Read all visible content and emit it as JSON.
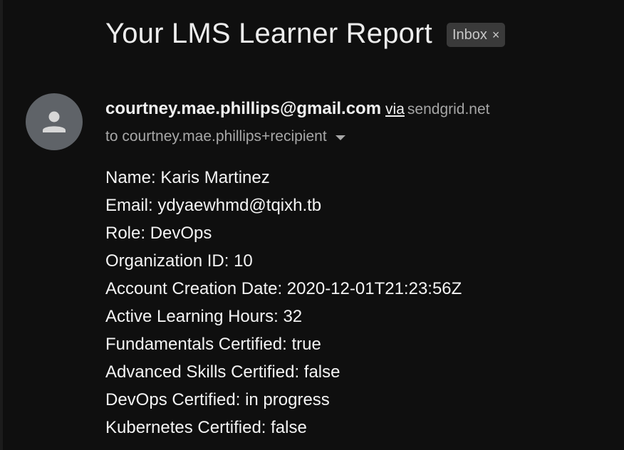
{
  "email": {
    "subject": "Your LMS Learner Report",
    "label": "Inbox",
    "label_close": "×",
    "sender": "courtney.mae.phillips@gmail.com",
    "via_text": "via",
    "via_domain": "sendgrid.net",
    "recipient": "to courtney.mae.phillips+recipient",
    "avatar_icon": "person-icon",
    "body_lines": [
      "Name: Karis Martinez",
      "Email: ydyaewhmd@tqixh.tb",
      "Role: DevOps",
      "Organization ID: 10",
      "Account Creation Date: 2020-12-01T21:23:56Z",
      "Active Learning Hours: 32",
      "Fundamentals Certified: true",
      "Advanced Skills Certified: false",
      "DevOps Certified: in progress",
      "Kubernetes Certified: false"
    ]
  },
  "colors": {
    "background": "#0f0f0f",
    "avatar": "#5f6368",
    "chip": "#3a3a3a",
    "text_primary": "#f4f4f4",
    "text_secondary": "#a8a8a8"
  }
}
